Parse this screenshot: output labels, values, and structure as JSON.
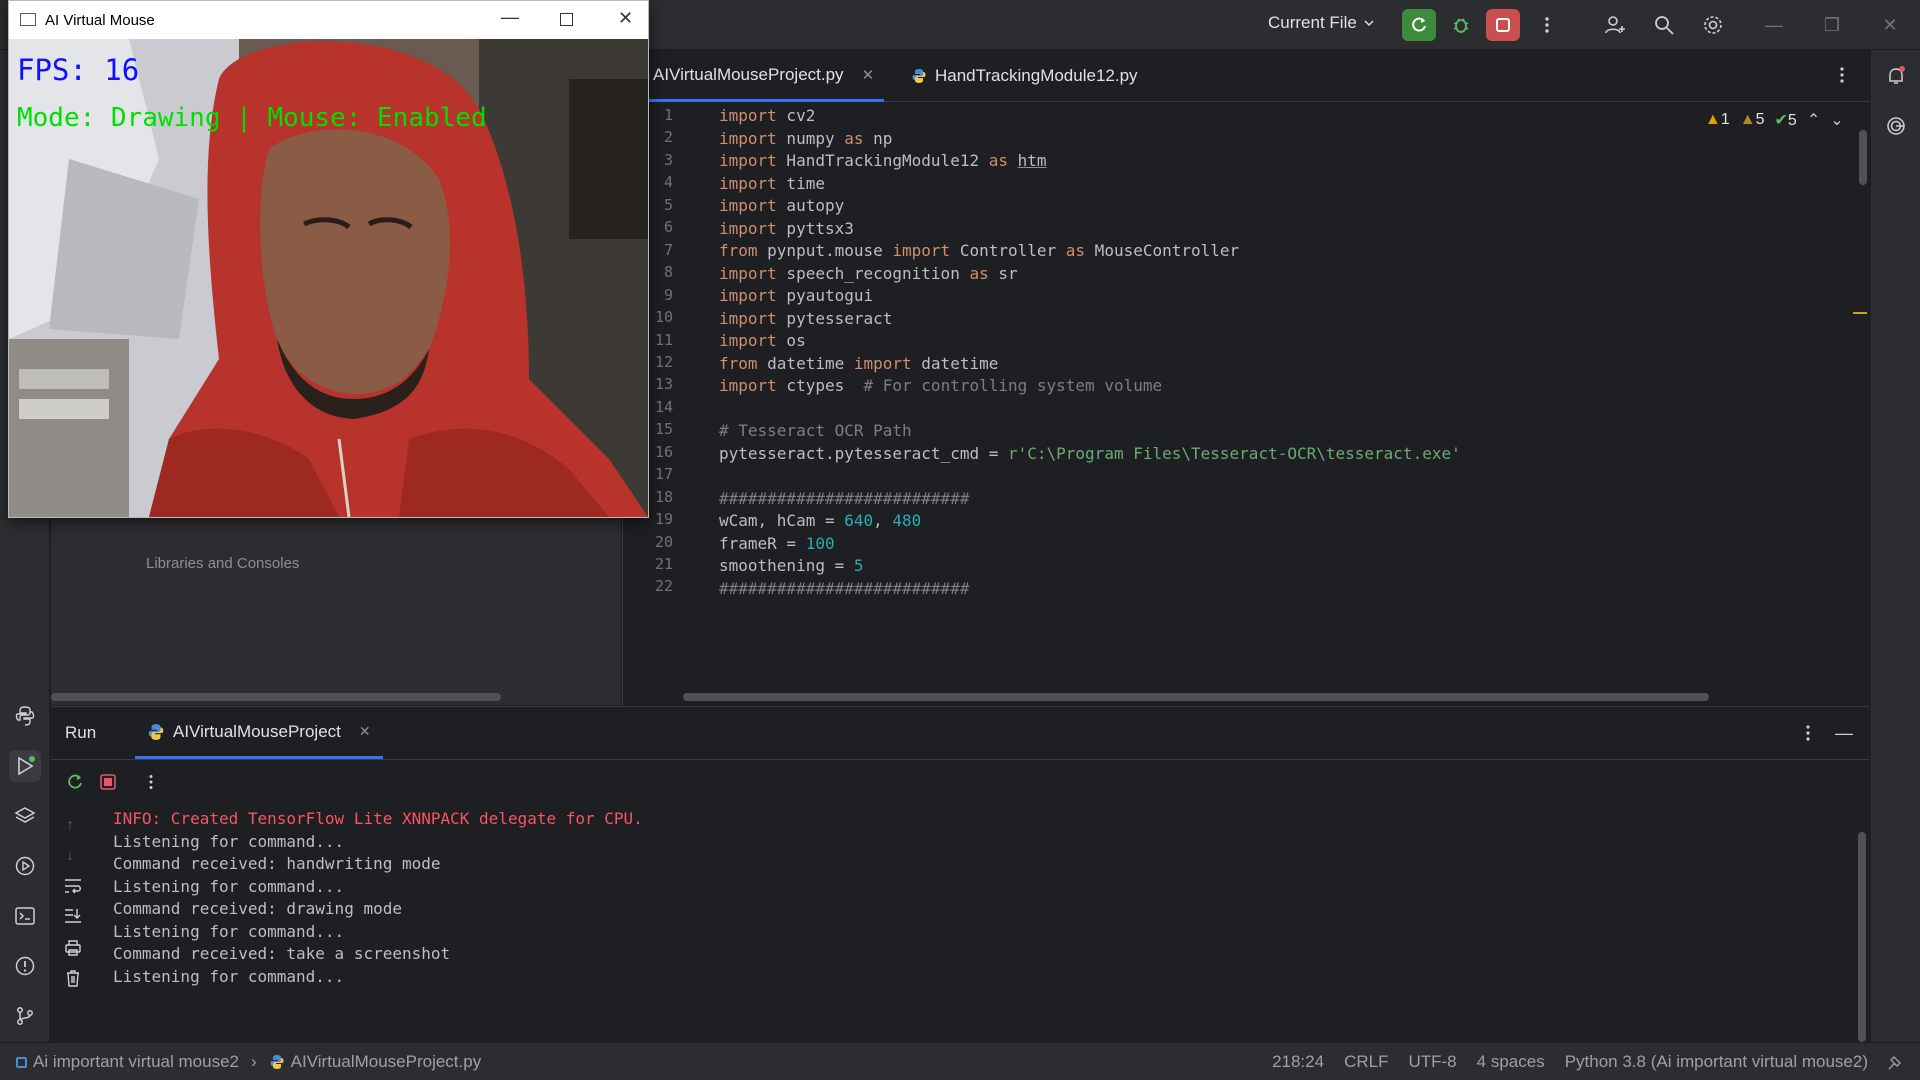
{
  "topbar": {
    "run_config": "Current File",
    "colors": {
      "run": "#3c8c3c",
      "stop": "#c94f4f"
    }
  },
  "editor": {
    "tabs": [
      {
        "label": "AIVirtualMouseProject.py",
        "active": true
      },
      {
        "label": "HandTrackingModule12.py",
        "active": false
      }
    ],
    "inspections": {
      "errors": "1",
      "warnings": "5",
      "ok": "5"
    },
    "line_numbers": [
      "1",
      "2",
      "3",
      "4",
      "5",
      "6",
      "7",
      "8",
      "9",
      "10",
      "11",
      "12",
      "13",
      "14",
      "15",
      "16",
      "17",
      "18",
      "19",
      "20",
      "21",
      "22"
    ],
    "code": {
      "l1": [
        "import",
        " cv2"
      ],
      "l2": [
        "import",
        " numpy ",
        "as",
        " np"
      ],
      "l3": [
        "import",
        " HandTrackingModule12 ",
        "as",
        " ",
        "htm"
      ],
      "l4": [
        "import",
        " time"
      ],
      "l5": [
        "import",
        " autopy"
      ],
      "l6": [
        "import",
        " pyttsx3"
      ],
      "l7": [
        "from",
        " pynput.mouse ",
        "import",
        " Controller ",
        "as",
        " MouseController"
      ],
      "l8": [
        "import",
        " speech_recognition ",
        "as",
        " sr"
      ],
      "l9": [
        "import",
        " pyautogui"
      ],
      "l10": [
        "import",
        " pytesseract"
      ],
      "l11": [
        "import",
        " os"
      ],
      "l12": [
        "from",
        " datetime ",
        "import",
        " datetime"
      ],
      "l13": [
        "import",
        " ctypes  ",
        "# For controlling system volume"
      ],
      "l15": "# Tesseract OCR Path",
      "l16": [
        "pytesseract.pytesseract_cmd = ",
        "r'C:\\Program Files\\Tesseract-OCR\\tesseract.exe'"
      ],
      "l18": "##########################",
      "l19": [
        "wCam, hCam = ",
        "640",
        ", ",
        "480"
      ],
      "l20": [
        "frameR = ",
        "100"
      ],
      "l21": [
        "smoothening = ",
        "5"
      ],
      "l22": "##########################"
    }
  },
  "run": {
    "title": "Run",
    "tab_label": "AIVirtualMouseProject",
    "console": [
      {
        "text": "INFO: Created TensorFlow Lite XNNPACK delegate for CPU.",
        "color": "#f75464"
      },
      {
        "text": "Listening for command...",
        "color": "#bcbec4"
      },
      {
        "text": "Command received: handwriting mode",
        "color": "#bcbec4"
      },
      {
        "text": "Listening for command...",
        "color": "#bcbec4"
      },
      {
        "text": "Command received: drawing mode",
        "color": "#bcbec4"
      },
      {
        "text": "Listening for command...",
        "color": "#bcbec4"
      },
      {
        "text": "Command received: take a screenshot",
        "color": "#bcbec4"
      },
      {
        "text": "Listening for command...",
        "color": "#bcbec4"
      }
    ]
  },
  "project_panel": {
    "faded_text": "Libraries and Consoles"
  },
  "statusbar": {
    "project": "Ai important virtual mouse2",
    "file": "AIVirtualMouseProject.py",
    "position": "218:24",
    "line_sep": "CRLF",
    "encoding": "UTF-8",
    "indent": "4 spaces",
    "interpreter": "Python 3.8 (Ai important virtual mouse2)"
  },
  "camera_window": {
    "title": "AI Virtual Mouse",
    "fps_text": "FPS: 16",
    "mode_text": "Mode: Drawing | Mouse: Enabled",
    "colors": {
      "fps": "#1010ff",
      "mode": "#00e000"
    }
  }
}
